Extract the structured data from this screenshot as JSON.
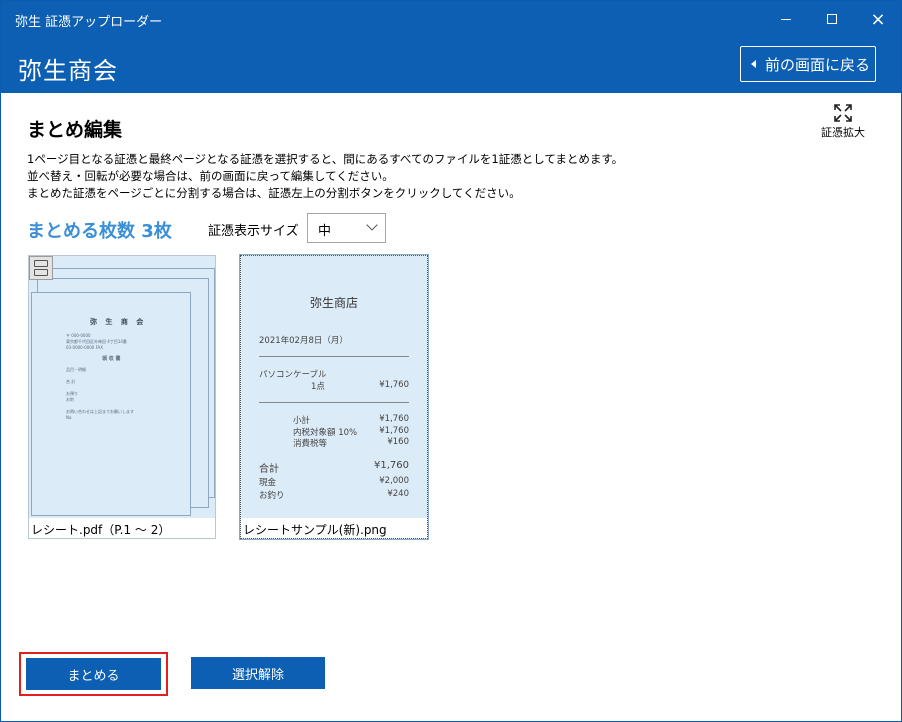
{
  "window": {
    "title": "弥生 証憑アップローダー",
    "controls": {
      "minimize": "minimize-icon",
      "maximize": "maximize-icon",
      "close": "×"
    }
  },
  "header": {
    "company_name": "弥生商会",
    "back_button_label": "前の画面に戻る"
  },
  "main": {
    "section_title": "まとめ編集",
    "expand_label": "証憑拡大",
    "description": [
      "1ページ目となる証憑と最終ページとなる証憑を選択すると、間にあるすべてのファイルを1証憑としてまとめます。",
      "並べ替え・回転が必要な場合は、前の画面に戻って編集してください。",
      "まとめた証憑をページごとに分割する場合は、証憑左上の分割ボタンをクリックしてください。"
    ],
    "count_label": "まとめる枚数 3枚",
    "size_label": "証憑表示サイズ",
    "size_selected": "中"
  },
  "thumbnails": [
    {
      "caption": "レシート.pdf（P.1 ～ 2）",
      "preview": {
        "title": "弥 生 商 会",
        "heading": "領 収 書",
        "lines": [
          "〒 000-0000",
          "東京都千代田区外神田 4丁目14番",
          "03-0000-0000   FAX",
          "品目・明細",
          "合 計",
          "お預り",
          "お釣",
          "お問い合わせは上記までお願いします",
          "No.",
          "No."
        ]
      }
    },
    {
      "caption": "レシートサンプル(新).png",
      "receipt": {
        "store": "弥生商店",
        "date": "2021年02月8日（月）",
        "item_name": "パソコンケーブル",
        "item_qty": "1点",
        "item_price": "¥1,760",
        "subtotal_label": "小計",
        "subtotal": "¥1,760",
        "tax_base_label": "内税対象額  10%",
        "tax_base": "¥1,760",
        "tax_label": "消費税等",
        "tax": "¥160",
        "total_label": "合計",
        "total": "¥1,760",
        "cash_label": "現金",
        "cash": "¥2,000",
        "change_label": "お釣り",
        "change": "¥240"
      }
    }
  ],
  "footer": {
    "merge_button_label": "まとめる",
    "clear_button_label": "選択解除"
  },
  "colors": {
    "brand_blue": "#0d5fb3",
    "accent_blue": "#3a8fd6",
    "focus_red": "#e0201f",
    "thumbnail_bg": "#dcebf8"
  }
}
